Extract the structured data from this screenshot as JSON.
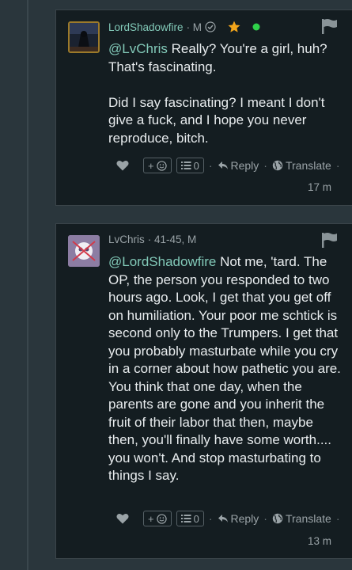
{
  "comments": [
    {
      "username": "LordShadowfire",
      "meta": "· M",
      "mention": "@LvChris",
      "paragraphs": [
        " Really? You're a girl, huh? That's fascinating.",
        "Did I say fascinating? I meant I don't give a fuck, and I hope you never reproduce, bitch."
      ],
      "add_reaction": "+",
      "replies_count": "0",
      "reply_label": "Reply",
      "translate_label": "Translate",
      "time": "17 m",
      "online_color": "#2fd14a",
      "star_color": "#f2a51b"
    },
    {
      "username": "LvChris",
      "meta": "· 41-45, M",
      "mention": "@LordShadowfire",
      "paragraphs": [
        " Not me, 'tard. The OP, the person you responded to two hours ago. Look, I get that you get off on humiliation. Your poor me schtick is second only to the Trumpers. I get that you probably masturbate while you cry in a corner about how pathetic you are. You think that one day, when the parents are gone and you inherit the fruit of their labor that then, maybe then, you'll finally have some worth.... you won't. And stop masturbating to things I say."
      ],
      "add_reaction": "+",
      "replies_count": "0",
      "reply_label": "Reply",
      "translate_label": "Translate",
      "time": "13 m"
    }
  ]
}
